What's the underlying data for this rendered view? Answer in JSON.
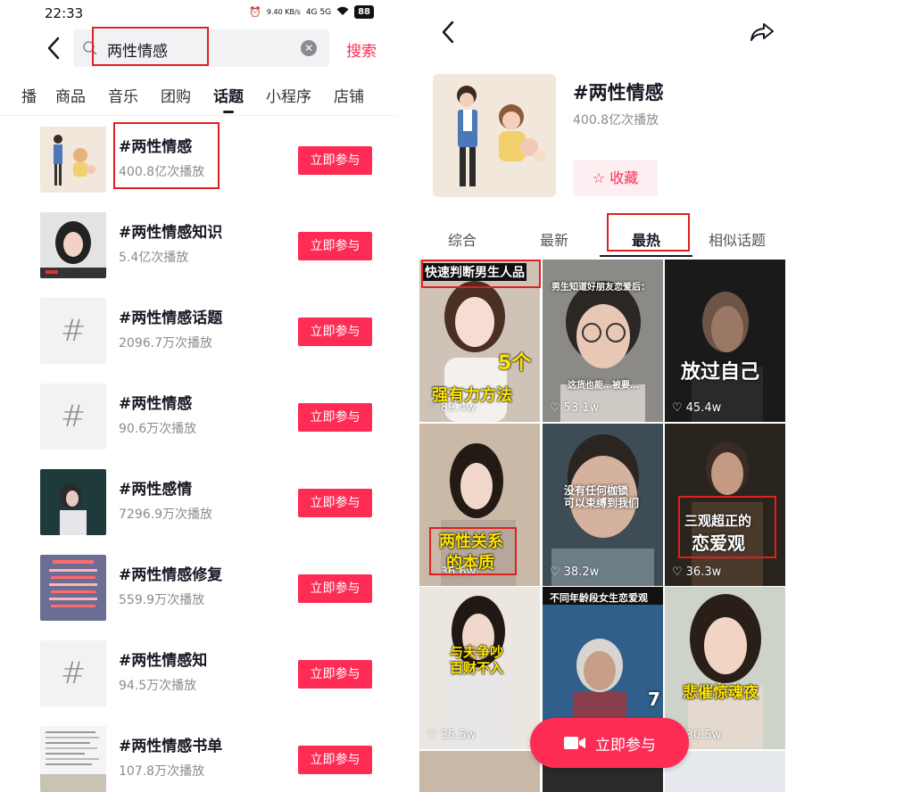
{
  "left": {
    "status": {
      "time": "22:33",
      "net_speed": "9.40 KB/s",
      "signal": "4G 5G",
      "battery": "88"
    },
    "search": {
      "query": "两性情感",
      "button_label": "搜索",
      "clear_icon": "clear-icon"
    },
    "tabs": [
      {
        "label": "播",
        "active": false
      },
      {
        "label": "商品",
        "active": false
      },
      {
        "label": "音乐",
        "active": false
      },
      {
        "label": "团购",
        "active": false
      },
      {
        "label": "话题",
        "active": true
      },
      {
        "label": "小程序",
        "active": false
      },
      {
        "label": "店铺",
        "active": false
      }
    ],
    "results": [
      {
        "title": "#两性情感",
        "views": "400.8亿次播放",
        "thumb": "image",
        "join_label": "立即参与"
      },
      {
        "title": "#两性情感知识",
        "views": "5.4亿次播放",
        "thumb": "image",
        "join_label": "立即参与"
      },
      {
        "title": "#两性情感话题",
        "views": "2096.7万次播放",
        "thumb": "#",
        "join_label": "立即参与"
      },
      {
        "title": "#两性情感",
        "views": "90.6万次播放",
        "thumb": "#",
        "join_label": "立即参与"
      },
      {
        "title": "#两性感情",
        "views": "7296.9万次播放",
        "thumb": "image",
        "join_label": "立即参与"
      },
      {
        "title": "#两性情感修复",
        "views": "559.9万次播放",
        "thumb": "image",
        "join_label": "立即参与"
      },
      {
        "title": "#两性情感知",
        "views": "94.5万次播放",
        "thumb": "#",
        "join_label": "立即参与"
      },
      {
        "title": "#两性情感书单",
        "views": "107.8万次播放",
        "thumb": "image",
        "join_label": "立即参与"
      }
    ]
  },
  "right": {
    "title": "#两性情感",
    "views": "400.8亿次播放",
    "favorite_label": "收藏",
    "tabs": [
      {
        "label": "综合",
        "active": false
      },
      {
        "label": "最新",
        "active": false
      },
      {
        "label": "最热",
        "active": true
      },
      {
        "label": "相似话题",
        "active": false
      }
    ],
    "videos": [
      {
        "caption": "快速判断男生人品",
        "caption2": "5个",
        "caption3": "强有力方法",
        "likes": "89.4w"
      },
      {
        "caption": "男生知道好朋友恋爱后：",
        "caption2": "这货也能…被要…",
        "likes": "53.1w"
      },
      {
        "caption": "放过自己",
        "likes": "45.4w"
      },
      {
        "caption": "两性关系",
        "caption2": "的本质",
        "likes": "36.6w"
      },
      {
        "caption": "没有任何枷锁",
        "caption2": "可以束缚到我们",
        "likes": "38.2w"
      },
      {
        "caption": "三观超正的",
        "caption2": "恋爱观",
        "likes": "36.3w"
      },
      {
        "caption": "与夫争吵",
        "caption2": "百财不入",
        "likes": "35.5w"
      },
      {
        "caption": "不同年龄段女生恋爱观",
        "caption2": "7",
        "likes": ""
      },
      {
        "caption": "悲催惊魂夜",
        "likes": "30.5w"
      }
    ],
    "fab_label": "立即参与"
  }
}
